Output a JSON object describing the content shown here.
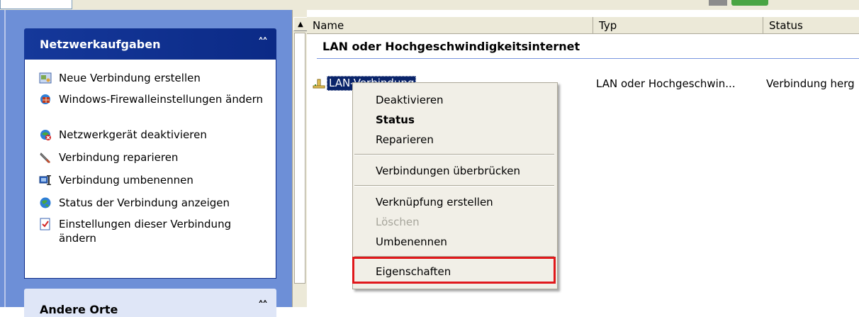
{
  "colors": {
    "taskpane_bg": "#6d8fd7",
    "panel_head": "#0b2a86",
    "selection": "#0a246a",
    "highlight_box": "#e0181b"
  },
  "taskpane": {
    "network_tasks": {
      "title": "Netzwerkaufgaben",
      "collapse_glyph": "˄˄",
      "items": [
        {
          "icon": "new-connection-icon",
          "label": "Neue Verbindung erstellen"
        },
        {
          "icon": "firewall-icon",
          "label": "Windows-Firewalleinstellungen ändern"
        },
        {
          "icon": "disable-device-icon",
          "label": "Netzwerkgerät deaktivieren"
        },
        {
          "icon": "repair-icon",
          "label": "Verbindung reparieren"
        },
        {
          "icon": "rename-icon",
          "label": "Verbindung umbenennen"
        },
        {
          "icon": "status-icon",
          "label": "Status der Verbindung anzeigen"
        },
        {
          "icon": "settings-icon",
          "label": "Einstellungen dieser Verbindung ändern"
        }
      ]
    },
    "other_places": {
      "title": "Andere Orte",
      "collapse_glyph": "˄˄"
    }
  },
  "list": {
    "columns": [
      "Name",
      "Typ",
      "Status"
    ],
    "group_title": "LAN oder Hochgeschwindigkeitsinternet",
    "item": {
      "name": "LAN-Verbindung",
      "type": "LAN oder Hochgeschwin...",
      "status": "Verbindung herg"
    }
  },
  "context_menu": {
    "items": [
      {
        "label": "Deaktivieren"
      },
      {
        "label": "Status"
      },
      {
        "label": "Reparieren"
      },
      {
        "label": "Verbindungen überbrücken"
      },
      {
        "label": "Verknüpfung erstellen"
      },
      {
        "label": "Löschen"
      },
      {
        "label": "Umbenennen"
      },
      {
        "label": "Eigenschaften"
      }
    ]
  },
  "scrollbar": {
    "up_arrow": "▲"
  }
}
